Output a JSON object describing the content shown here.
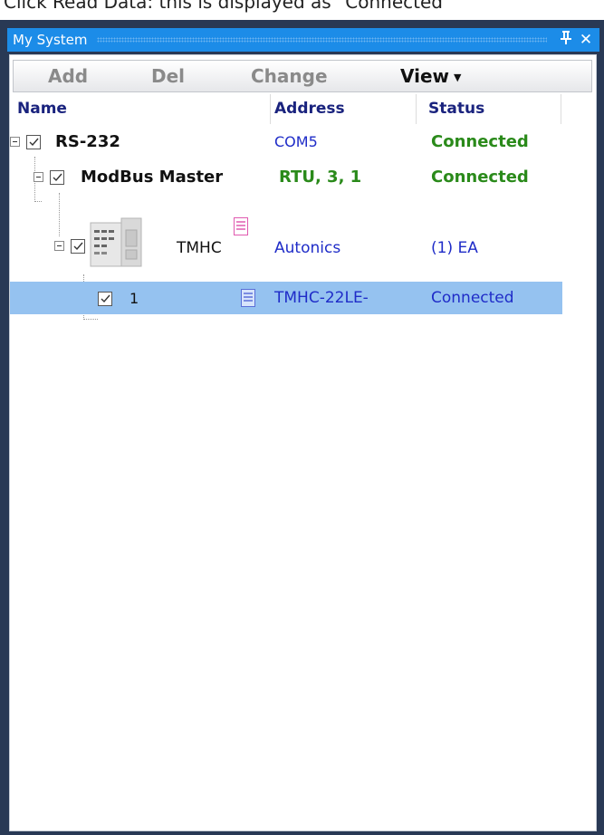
{
  "top_caption": "Click Read Data: this is displayed as \"Connected\"",
  "window": {
    "title": "My System",
    "pin_label": "Ԅ",
    "close_label": "✕"
  },
  "toolbar": {
    "add_label": "Add",
    "del_label": "Del",
    "change_label": "Change",
    "view_label": "View"
  },
  "columns": {
    "name": "Name",
    "address": "Address",
    "status": "Status"
  },
  "rows": [
    {
      "name": "RS-232",
      "address": "COM5",
      "status": "Connected"
    },
    {
      "name": "ModBus Master",
      "address": "RTU, 3, 1",
      "status": "Connected"
    },
    {
      "name": "TMHC",
      "address": "Autonics",
      "status": "(1) EA"
    },
    {
      "name": "1",
      "address": "TMHC-22LE-",
      "status": "Connected"
    }
  ],
  "colors": {
    "titlebar": "#1c8ce8",
    "frame": "#293955",
    "selected_row": "#95c2f0",
    "connected_green": "#2a8a1a",
    "address_blue": "#1f2cc8",
    "header_text": "#1a237e"
  },
  "icons": {
    "pin": "pin-icon",
    "close": "close-icon",
    "dropdown": "chevron-down-icon",
    "device": "controller-device-icon",
    "doc_pink": "document-icon",
    "doc_blue": "document-icon"
  }
}
